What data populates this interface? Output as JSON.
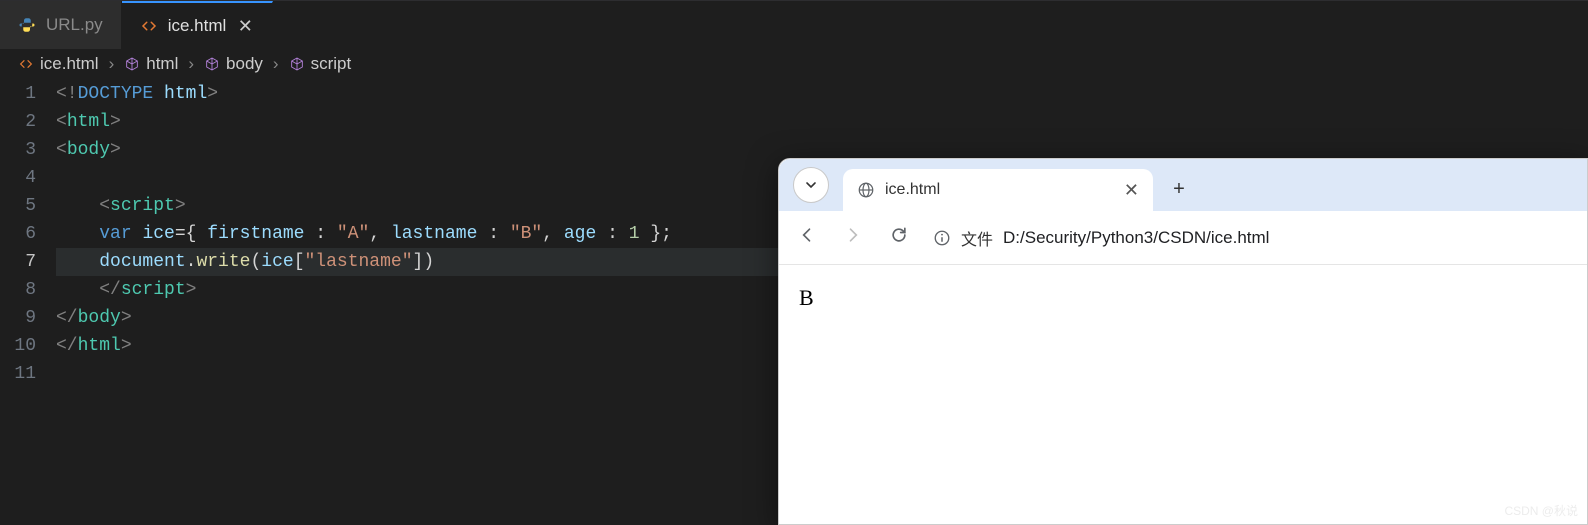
{
  "editor": {
    "tabs": [
      {
        "name": "URL.py",
        "active": false,
        "icon": "python"
      },
      {
        "name": "ice.html",
        "active": true,
        "icon": "html"
      }
    ],
    "breadcrumb": [
      "ice.html",
      "html",
      "body",
      "script"
    ],
    "active_line": 7,
    "code_lines": [
      {
        "n": 1,
        "indent": 0,
        "tokens": [
          [
            "punc",
            "<!"
          ],
          [
            "doctype",
            "DOCTYPE"
          ],
          [
            "text",
            " "
          ],
          [
            "attr",
            "html"
          ],
          [
            "punc",
            ">"
          ]
        ]
      },
      {
        "n": 2,
        "indent": 0,
        "tokens": [
          [
            "punc",
            "<"
          ],
          [
            "tag",
            "html"
          ],
          [
            "punc",
            ">"
          ]
        ]
      },
      {
        "n": 3,
        "indent": 0,
        "tokens": [
          [
            "punc",
            "<"
          ],
          [
            "tag",
            "body"
          ],
          [
            "punc",
            ">"
          ]
        ]
      },
      {
        "n": 4,
        "indent": 1,
        "tokens": []
      },
      {
        "n": 5,
        "indent": 1,
        "tokens": [
          [
            "punc",
            "<"
          ],
          [
            "tag",
            "script"
          ],
          [
            "punc",
            ">"
          ]
        ]
      },
      {
        "n": 6,
        "indent": 1,
        "tokens": [
          [
            "keyword",
            "var"
          ],
          [
            "text",
            " "
          ],
          [
            "var",
            "ice"
          ],
          [
            "op",
            "="
          ],
          [
            "op",
            "{ "
          ],
          [
            "var",
            "firstname"
          ],
          [
            "text",
            " "
          ],
          [
            "op",
            ":"
          ],
          [
            "text",
            " "
          ],
          [
            "string",
            "\"A\""
          ],
          [
            "op",
            ","
          ],
          [
            "text",
            " "
          ],
          [
            "var",
            "lastname"
          ],
          [
            "text",
            " "
          ],
          [
            "op",
            ":"
          ],
          [
            "text",
            " "
          ],
          [
            "string",
            "\"B\""
          ],
          [
            "op",
            ","
          ],
          [
            "text",
            " "
          ],
          [
            "var",
            "age"
          ],
          [
            "text",
            " "
          ],
          [
            "op",
            ":"
          ],
          [
            "text",
            " "
          ],
          [
            "num",
            "1"
          ],
          [
            "text",
            " "
          ],
          [
            "op",
            "}"
          ],
          [
            "op",
            ";"
          ]
        ]
      },
      {
        "n": 7,
        "indent": 1,
        "tokens": [
          [
            "var",
            "document"
          ],
          [
            "op",
            "."
          ],
          [
            "func",
            "write"
          ],
          [
            "op",
            "("
          ],
          [
            "var",
            "ice"
          ],
          [
            "op",
            "["
          ],
          [
            "string",
            "\"lastname\""
          ],
          [
            "op",
            "]"
          ],
          [
            "op",
            ")"
          ]
        ]
      },
      {
        "n": 8,
        "indent": 1,
        "tokens": [
          [
            "punc",
            "</"
          ],
          [
            "tag",
            "script"
          ],
          [
            "punc",
            ">"
          ]
        ]
      },
      {
        "n": 9,
        "indent": 0,
        "tokens": [
          [
            "punc",
            "</"
          ],
          [
            "tag",
            "body"
          ],
          [
            "punc",
            ">"
          ]
        ]
      },
      {
        "n": 10,
        "indent": 0,
        "tokens": [
          [
            "punc",
            "</"
          ],
          [
            "tag",
            "html"
          ],
          [
            "punc",
            ">"
          ]
        ]
      },
      {
        "n": 11,
        "indent": 0,
        "tokens": []
      }
    ]
  },
  "browser": {
    "tab_title": "ice.html",
    "address_label": "文件",
    "address_path": "D:/Security/Python3/CSDN/ice.html",
    "page_output": "B"
  },
  "watermark": "CSDN @秋说"
}
